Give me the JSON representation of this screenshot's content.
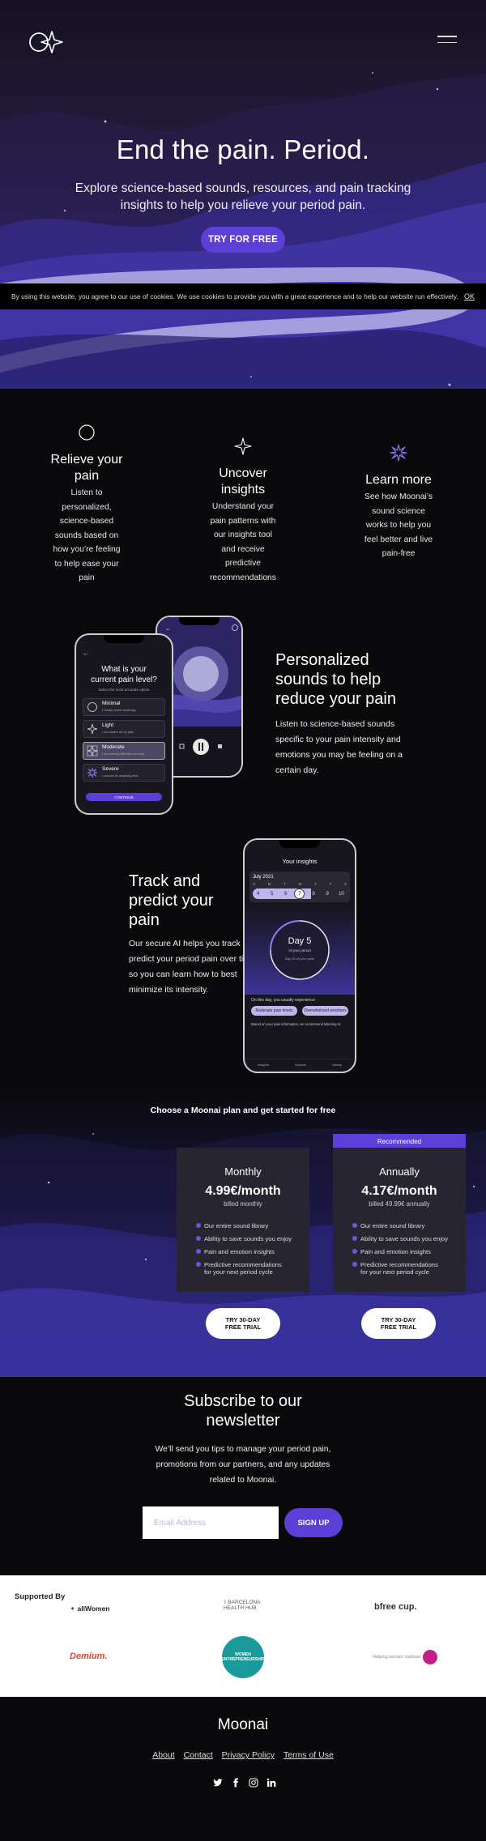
{
  "hero": {
    "title": "End the pain. Period.",
    "subtitle": "Explore science-based sounds, resources, and pain tracking insights to help you relieve your period pain.",
    "cta": "TRY FOR FREE"
  },
  "cookie": {
    "text": "By using this website, you agree to our use of cookies. We use cookies to provide you with a great experience and to help our website run effectively.",
    "ok": "OK"
  },
  "features": [
    {
      "title": "Relieve your pain",
      "text": "Listen to personalized, science-based sounds based on how you’re feeling to help ease your pain",
      "icon": "circle-icon"
    },
    {
      "title": "Uncover insights",
      "text": "Understand your pain patterns with our insights tool and receive predictive recommendations",
      "icon": "sparkle-icon"
    },
    {
      "title": "Learn more",
      "text": "See how Moonai’s sound science works to help you feel better and live pain-free",
      "icon": "star-burst-icon"
    }
  ],
  "personalized": {
    "title": "Personalized sounds to help reduce your pain",
    "text": "Listen to science-based sounds specific to your pain intensity and emotions you may be feeling on a certain day.",
    "phone": {
      "question": "What is your current pain level?",
      "hint": "Select the most accurate option",
      "options": [
        {
          "label": "Minimal",
          "desc": "I hardly notice anything"
        },
        {
          "label": "Light",
          "desc": "I am aware of my pain"
        },
        {
          "label": "Moderate",
          "desc": "I am having difficulty focusing"
        },
        {
          "label": "Severe",
          "desc": "I cannot do anything else"
        }
      ],
      "continue": "CONTINUE"
    }
  },
  "track": {
    "title": "Track and predict your pain",
    "text": "Our secure AI helps you track and predict your period pain over time so you can learn how to best minimize its intensity.",
    "phone": {
      "header": "Your insights",
      "month": "July 2021",
      "weekdays": [
        "S",
        "M",
        "T",
        "W",
        "T",
        "F",
        "S"
      ],
      "days": [
        "4",
        "5",
        "6",
        "7",
        "8",
        "9",
        "10"
      ],
      "day_label": "Day 5",
      "day_sub": "of your period",
      "day_sub2": "Day 24 of your cycle",
      "experience": "On this day, you usually experience:",
      "chips": [
        "Moderate pain levels",
        "Overwhelmed emotions"
      ],
      "recommend": "Based on your pain information, we recommend listening to:",
      "nav": [
        "Insights",
        "Sounds",
        "Library"
      ]
    }
  },
  "pricing": {
    "title": "Choose a Moonai plan and get started for free",
    "recommended": "Recommended",
    "plans": [
      {
        "name": "Monthly",
        "price": "4.99€/month",
        "billed": "billed monthly",
        "cta": "TRY 30-DAY FREE TRIAL"
      },
      {
        "name": "Annually",
        "price": "4.17€/month",
        "billed": "billed 49.99€ annually",
        "cta": "TRY 30-DAY FREE TRIAL"
      }
    ],
    "features": [
      "Our entire sound library",
      "Ability to save sounds you enjoy",
      "Pain and emotion insights",
      "Predictive recommendations for your next period cycle"
    ]
  },
  "newsletter": {
    "title": "Subscribe to our newsletter",
    "text": "We’ll send you tips to manage your period pain, promotions from our partners, and any updates related to Moonai.",
    "placeholder": "Email Address",
    "button": "SIGN UP"
  },
  "supporters": {
    "label": "Supported By",
    "items": [
      "allWomen",
      "BARCELONA HEALTH HUB",
      "bfree cup.",
      "Demium.",
      "WOMEN ENTREPRENEURSHIP",
      "Helping women startups"
    ]
  },
  "footer": {
    "brand": "Moonai",
    "links": [
      "About",
      "Contact",
      "Privacy Policy",
      "Terms of Use"
    ],
    "social": [
      "twitter-icon",
      "facebook-icon",
      "instagram-icon",
      "linkedin-icon"
    ]
  },
  "colors": {
    "accent": "#5b3fd6",
    "background": "#0a0a0c",
    "hero_purple": "#3a2fa0",
    "card": "#27252f"
  }
}
